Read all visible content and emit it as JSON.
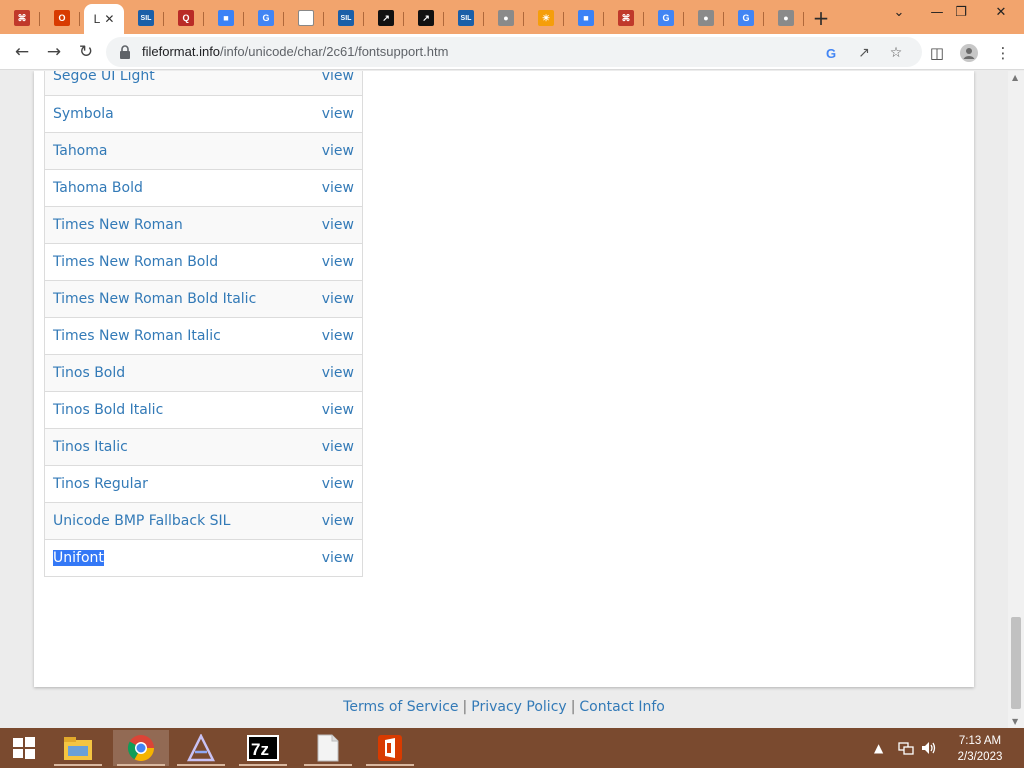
{
  "browser": {
    "tabs": [
      {
        "icon": "fileformat-icon",
        "color": "#c0392b",
        "glyph": "⌘"
      },
      {
        "icon": "office-icon",
        "color": "#d83b01",
        "glyph": "O"
      },
      {
        "icon": "active-tab",
        "letter": "L",
        "active": true
      },
      {
        "icon": "sil-icon",
        "color": "#1b5fa8",
        "glyph": "SIL"
      },
      {
        "icon": "quora-icon",
        "color": "#b92b27",
        "glyph": "Q"
      },
      {
        "icon": "multicolor-icon",
        "color": "#3b82f6",
        "glyph": "■"
      },
      {
        "icon": "google-icon",
        "color": "#4285f4",
        "glyph": "G"
      },
      {
        "icon": "document-icon",
        "color": "#ffffff",
        "glyph": ""
      },
      {
        "icon": "sil-icon",
        "color": "#1b5fa8",
        "glyph": "SIL"
      },
      {
        "icon": "blackcircle-icon",
        "color": "#111111",
        "glyph": "↗"
      },
      {
        "icon": "blackcircle-icon",
        "color": "#111111",
        "glyph": "↗"
      },
      {
        "icon": "sil-icon",
        "color": "#1b5fa8",
        "glyph": "SIL"
      },
      {
        "icon": "globe-icon",
        "color": "#8a8a8a",
        "glyph": "●"
      },
      {
        "icon": "sun-icon",
        "color": "#f59e0b",
        "glyph": "☀"
      },
      {
        "icon": "multicolor-icon",
        "color": "#3b82f6",
        "glyph": "■"
      },
      {
        "icon": "fileformat-icon",
        "color": "#c0392b",
        "glyph": "⌘"
      },
      {
        "icon": "google-icon",
        "color": "#4285f4",
        "glyph": "G"
      },
      {
        "icon": "globe-icon",
        "color": "#8a8a8a",
        "glyph": "●"
      },
      {
        "icon": "google-icon",
        "color": "#4285f4",
        "glyph": "G"
      },
      {
        "icon": "globe-icon",
        "color": "#8a8a8a",
        "glyph": "●"
      }
    ],
    "active_tab_letter": "L",
    "url_host": "fileformat.info",
    "url_path": "/info/unicode/char/2c61/fontsupport.htm",
    "tabstrip_color": "#f2a46d"
  },
  "fonts": [
    {
      "name": "Segoe UI Light",
      "link": "view"
    },
    {
      "name": "Symbola",
      "link": "view"
    },
    {
      "name": "Tahoma",
      "link": "view"
    },
    {
      "name": "Tahoma Bold",
      "link": "view"
    },
    {
      "name": "Times New Roman",
      "link": "view"
    },
    {
      "name": "Times New Roman Bold",
      "link": "view"
    },
    {
      "name": "Times New Roman Bold Italic",
      "link": "view"
    },
    {
      "name": "Times New Roman Italic",
      "link": "view"
    },
    {
      "name": "Tinos Bold",
      "link": "view"
    },
    {
      "name": "Tinos Bold Italic",
      "link": "view"
    },
    {
      "name": "Tinos Italic",
      "link": "view"
    },
    {
      "name": "Tinos Regular",
      "link": "view"
    },
    {
      "name": "Unicode BMP Fallback SIL",
      "link": "view"
    },
    {
      "name": "Unifont",
      "link": "view",
      "selected": true
    }
  ],
  "footer": {
    "terms": "Terms of Service",
    "privacy": "Privacy Policy",
    "contact": "Contact Info",
    "separator": "|"
  },
  "taskbar": {
    "apps": [
      "start-icon",
      "file-explorer-icon",
      "chrome-icon",
      "app-a-icon",
      "7zip-icon",
      "notepad-icon",
      "office-icon"
    ],
    "time": "7:13 AM",
    "date": "2/3/2023"
  },
  "colors": {
    "link": "#337ab7",
    "selection": "#3478f6",
    "taskbar": "#7a4a2f"
  }
}
